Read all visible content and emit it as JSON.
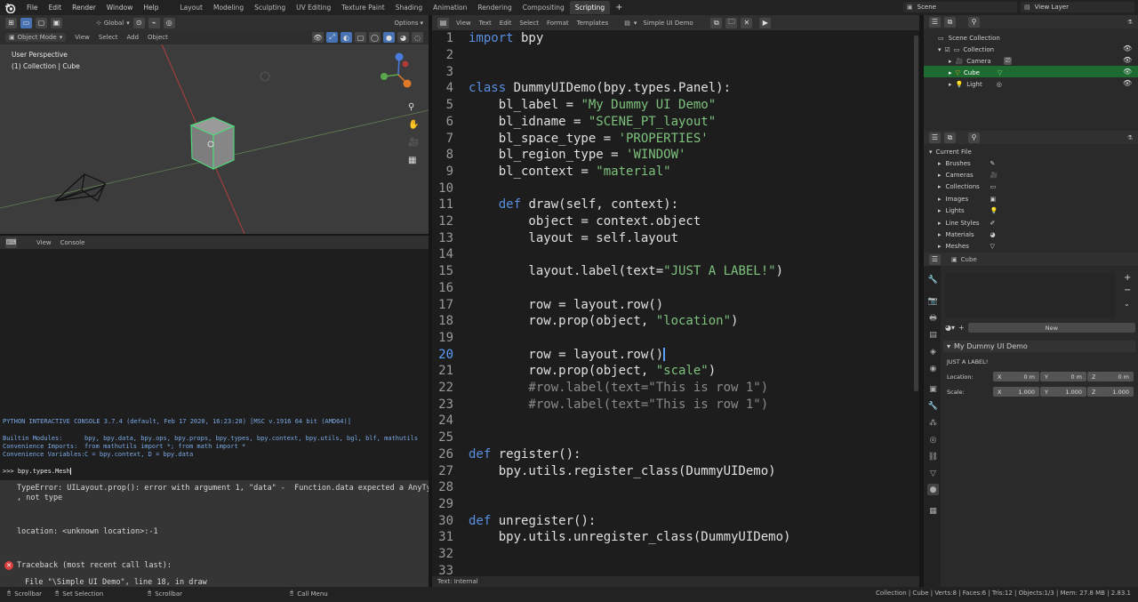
{
  "topbar": {
    "menus": [
      "File",
      "Edit",
      "Render",
      "Window",
      "Help"
    ],
    "workspaces": [
      "Layout",
      "Modeling",
      "Sculpting",
      "UV Editing",
      "Texture Paint",
      "Shading",
      "Animation",
      "Rendering",
      "Compositing",
      "Scripting"
    ],
    "active_workspace": "Scripting",
    "scene": "Scene",
    "view_layer": "View Layer"
  },
  "viewport": {
    "orientation": "Global",
    "options": "Options",
    "mode": "Object Mode",
    "menus": [
      "View",
      "Select",
      "Add",
      "Object"
    ],
    "overlay_line1": "User Perspective",
    "overlay_line2": "(1) Collection | Cube",
    "gizmo_axes": [
      "X",
      "Y",
      "Z"
    ]
  },
  "console": {
    "menus": [
      "View",
      "Console"
    ],
    "banner": "PYTHON INTERACTIVE CONSOLE 3.7.4 (default, Feb 17 2020, 16:23:28) [MSC v.1916 64 bit (AMD64)]",
    "builtin_label": "Builtin Modules:",
    "builtin_value": "bpy, bpy.data, bpy.ops, bpy.props, bpy.types, bpy.context, bpy.utils, bgl, blf, mathutils",
    "imports_label": "Convenience Imports:",
    "imports_value": "from mathutils import *; from math import *",
    "vars_label": "Convenience Variables:",
    "vars_value": "C = bpy.context, D = bpy.data",
    "prompt": ">>> bpy.types.Mesh",
    "error_line1": "TypeError: UILayout.prop(): error with argument 1, \"data\" -  Function.data expected a AnyType type",
    "error_line2": ", not type",
    "error_loc": "location: <unknown location>:-1",
    "traceback": "Traceback (most recent call last):",
    "traceback_file": "File \"\\Simple UI Demo\", line 18, in draw"
  },
  "text_editor": {
    "menus": [
      "View",
      "Text",
      "Edit",
      "Select",
      "Format",
      "Templates"
    ],
    "filename": "Simple UI Demo",
    "status": "Text: Internal",
    "current_line": 20,
    "lines": [
      {
        "n": "1",
        "segs": [
          {
            "t": "import",
            "c": "kw"
          },
          {
            "t": " bpy"
          }
        ]
      },
      {
        "n": "2",
        "segs": []
      },
      {
        "n": "3",
        "segs": []
      },
      {
        "n": "4",
        "segs": [
          {
            "t": "class",
            "c": "kw"
          },
          {
            "t": " DummyUIDemo(bpy.types.Panel):"
          }
        ]
      },
      {
        "n": "5",
        "segs": [
          {
            "t": "    bl_label = "
          },
          {
            "t": "\"My Dummy UI Demo\"",
            "c": "str"
          }
        ]
      },
      {
        "n": "6",
        "segs": [
          {
            "t": "    bl_idname = "
          },
          {
            "t": "\"SCENE_PT_layout\"",
            "c": "str"
          }
        ]
      },
      {
        "n": "7",
        "segs": [
          {
            "t": "    bl_space_type = "
          },
          {
            "t": "'PROPERTIES'",
            "c": "str"
          }
        ]
      },
      {
        "n": "8",
        "segs": [
          {
            "t": "    bl_region_type = "
          },
          {
            "t": "'WINDOW'",
            "c": "str"
          }
        ]
      },
      {
        "n": "9",
        "segs": [
          {
            "t": "    bl_context = "
          },
          {
            "t": "\"material\"",
            "c": "str"
          }
        ]
      },
      {
        "n": "10",
        "segs": []
      },
      {
        "n": "11",
        "segs": [
          {
            "t": "    "
          },
          {
            "t": "def",
            "c": "kw"
          },
          {
            "t": " draw(self, context):"
          }
        ]
      },
      {
        "n": "12",
        "segs": [
          {
            "t": "        object = context.object"
          }
        ]
      },
      {
        "n": "13",
        "segs": [
          {
            "t": "        layout = self.layout"
          }
        ]
      },
      {
        "n": "14",
        "segs": []
      },
      {
        "n": "15",
        "segs": [
          {
            "t": "        layout.label(text="
          },
          {
            "t": "\"JUST A LABEL!\"",
            "c": "str"
          },
          {
            "t": ")"
          }
        ]
      },
      {
        "n": "16",
        "segs": []
      },
      {
        "n": "17",
        "segs": [
          {
            "t": "        row = layout.row()"
          }
        ]
      },
      {
        "n": "18",
        "segs": [
          {
            "t": "        row.prop(object, "
          },
          {
            "t": "\"location\"",
            "c": "str"
          },
          {
            "t": ")"
          }
        ]
      },
      {
        "n": "19",
        "segs": []
      },
      {
        "n": "20",
        "segs": [
          {
            "t": "        row = layout.row()"
          }
        ]
      },
      {
        "n": "21",
        "segs": [
          {
            "t": "        row.prop(object, "
          },
          {
            "t": "\"scale\"",
            "c": "str"
          },
          {
            "t": ")"
          }
        ]
      },
      {
        "n": "22",
        "segs": [
          {
            "t": "        #row.label(text=\"This is row 1\")",
            "c": "cm"
          }
        ]
      },
      {
        "n": "23",
        "segs": [
          {
            "t": "        #row.label(text=\"This is row 1\")",
            "c": "cm"
          }
        ]
      },
      {
        "n": "24",
        "segs": []
      },
      {
        "n": "25",
        "segs": []
      },
      {
        "n": "26",
        "segs": [
          {
            "t": "def",
            "c": "kw"
          },
          {
            "t": " register():"
          }
        ]
      },
      {
        "n": "27",
        "segs": [
          {
            "t": "    bpy.utils.register_class(DummyUIDemo)"
          }
        ]
      },
      {
        "n": "28",
        "segs": []
      },
      {
        "n": "29",
        "segs": []
      },
      {
        "n": "30",
        "segs": [
          {
            "t": "def",
            "c": "kw"
          },
          {
            "t": " unregister():"
          }
        ]
      },
      {
        "n": "31",
        "segs": [
          {
            "t": "    bpy.utils.unregister_class(DummyUIDemo)"
          }
        ]
      },
      {
        "n": "32",
        "segs": []
      },
      {
        "n": "33",
        "segs": []
      }
    ]
  },
  "outliner": {
    "items": [
      "Scene Collection",
      "Collection",
      "Camera",
      "Cube",
      "Light"
    ]
  },
  "file_browser": {
    "root": "Current File",
    "items": [
      "Brushes",
      "Cameras",
      "Collections",
      "Images",
      "Lights",
      "Line Styles",
      "Materials",
      "Meshes"
    ]
  },
  "properties": {
    "object_name": "Cube",
    "new_button": "New",
    "panel_title": "My Dummy UI Demo",
    "label": "JUST A LABEL!",
    "location_label": "Location:",
    "scale_label": "Scale:",
    "axes": [
      "X",
      "Y",
      "Z"
    ],
    "location_values": [
      "0 m",
      "0 m",
      "0 m"
    ],
    "scale_values": [
      "1.000",
      "1.000",
      "1.000"
    ]
  },
  "statusbar": {
    "left": [
      "Scrollbar",
      "Set Selection",
      "Scrollbar",
      "Call Menu"
    ],
    "stats": "Collection | Cube | Verts:8 | Faces:6 | Tris:12 | Objects:1/3 | Mem: 27.8 MB | 2.83.1"
  },
  "colors": {
    "accent": "#4772b3",
    "selected_row": "#1d6b30",
    "selection_outline": "#4fd67a"
  }
}
